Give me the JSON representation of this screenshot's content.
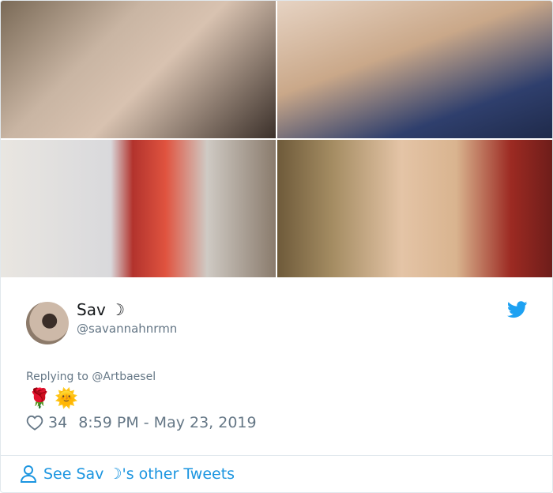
{
  "tweet": {
    "display_name": "Sav ☽",
    "handle": "@savannahnrmn",
    "replying_prefix": "Replying to",
    "replying_to": "@Artbaesel",
    "emoji_1": "🌹",
    "emoji_2": "🌞",
    "like_count": "34",
    "timestamp": "8:59 PM - May 23, 2019"
  },
  "footer": {
    "link_label": "See Sav ☽'s other Tweets"
  },
  "colors": {
    "link_blue": "#1b95e0",
    "muted_gray": "#657786",
    "twitter_blue": "#1da1f2"
  },
  "icons": [
    "twitter-bird-icon",
    "heart-icon",
    "person-icon"
  ]
}
